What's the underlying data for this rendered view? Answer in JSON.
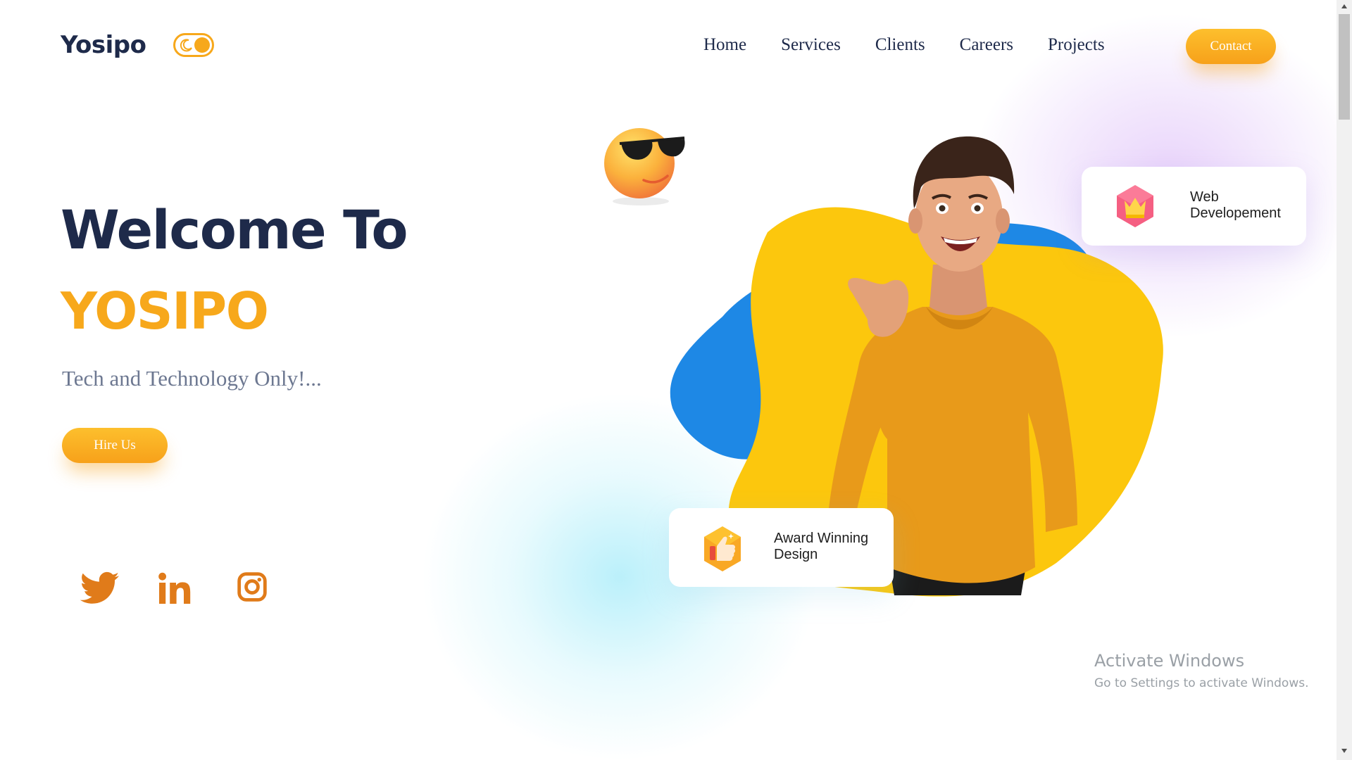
{
  "header": {
    "logo": "Yosipo",
    "nav": [
      {
        "label": "Home"
      },
      {
        "label": "Services"
      },
      {
        "label": "Clients"
      },
      {
        "label": "Careers"
      },
      {
        "label": "Projects"
      }
    ],
    "contact_label": "Contact"
  },
  "hero": {
    "title": "Welcome To",
    "brand": "YOSIPO",
    "tagline": "Tech and Technology Only!...",
    "hire_label": "Hire Us"
  },
  "social": [
    "twitter-icon",
    "linkedin-icon",
    "instagram-icon"
  ],
  "cards": {
    "web": "Web\nDevelopement",
    "award": "Award Winning\nDesign"
  },
  "watermark": {
    "line1": "Activate Windows",
    "line2": "Go to Settings to activate Windows."
  },
  "colors": {
    "accent": "#f7a81b",
    "navy": "#1e2a4a",
    "blob_blue": "#1e88e5",
    "blob_yellow": "#fcc70d",
    "sweater": "#e89a1a"
  }
}
